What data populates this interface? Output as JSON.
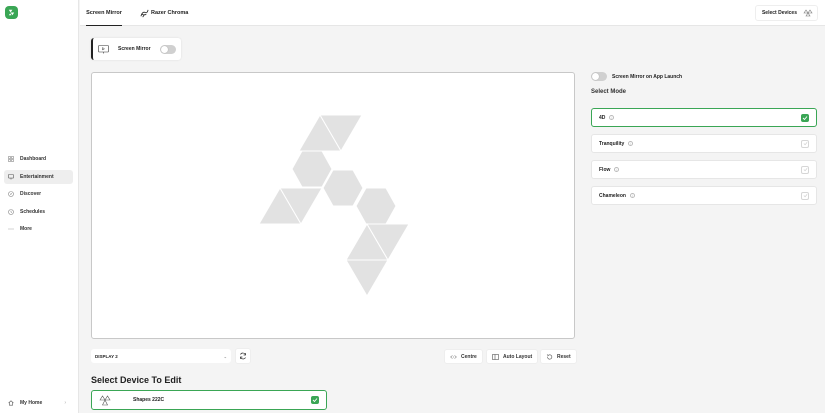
{
  "colors": {
    "accent": "#3aa655",
    "panel_shape": "#e2e2e2"
  },
  "sidebar": {
    "items": [
      {
        "label": "Dashboard",
        "icon": "grid-icon",
        "active": false
      },
      {
        "label": "Entertainment",
        "icon": "monitor-icon",
        "active": true
      },
      {
        "label": "Discover",
        "icon": "compass-icon",
        "active": false
      },
      {
        "label": "Schedules",
        "icon": "clock-icon",
        "active": false
      },
      {
        "label": "More",
        "icon": "ellipsis-icon",
        "active": false
      }
    ],
    "home_label": "My Home"
  },
  "topbar": {
    "tabs": [
      {
        "label": "Screen Mirror",
        "active": true
      },
      {
        "label": "Razer Chroma",
        "active": false
      }
    ],
    "select_devices_label": "Select Devices"
  },
  "mirror_card": {
    "label": "Screen Mirror",
    "enabled": false
  },
  "controls": {
    "display_value": "DISPLAY 2",
    "centre_label": "Centre",
    "auto_layout_label": "Auto Layout",
    "reset_label": "Reset"
  },
  "device_section": {
    "title": "Select Device To Edit",
    "devices": [
      {
        "name": "Shapes 222C",
        "selected": true
      }
    ]
  },
  "right_panel": {
    "launch_label": "Screen Mirror on App Launch",
    "launch_enabled": false,
    "mode_title": "Select Mode",
    "modes": [
      {
        "label": "4D",
        "selected": true
      },
      {
        "label": "Tranquility",
        "selected": false
      },
      {
        "label": "Flow",
        "selected": false
      },
      {
        "label": "Chameleon",
        "selected": false
      }
    ]
  }
}
